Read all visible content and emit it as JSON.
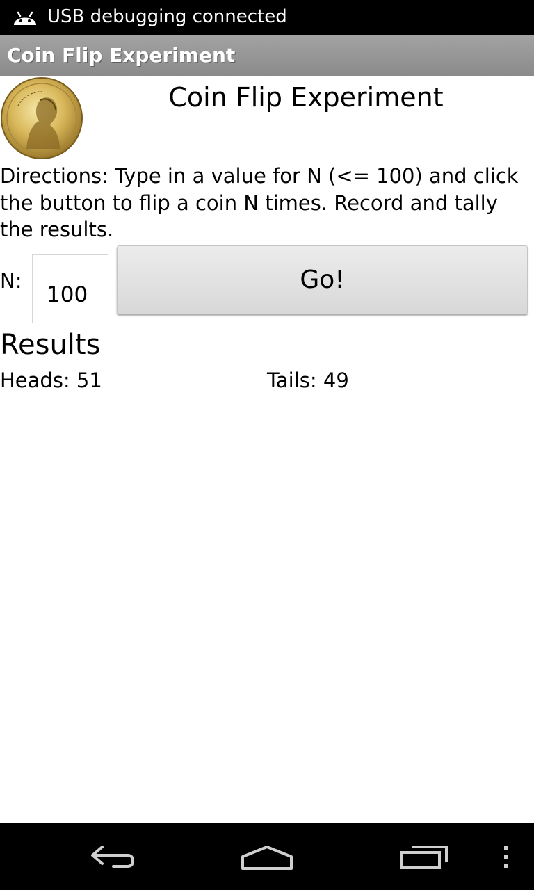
{
  "status_bar": {
    "text": "USB debugging connected",
    "icon": "android-debug-icon"
  },
  "action_bar": {
    "title": "Coin Flip Experiment"
  },
  "header": {
    "title": "Coin Flip Experiment",
    "image": "liberty-coin-image"
  },
  "directions": "Directions: Type in a value for N (<= 100) and click the button to flip a coin N times. Record and tally the results.",
  "input": {
    "label": "N:",
    "value": "100"
  },
  "go_button": {
    "label": "Go!"
  },
  "results": {
    "heading": "Results",
    "heads": "Heads: 51",
    "tails": "Tails:  49"
  },
  "nav_bar": {
    "back": "back-icon",
    "home": "home-icon",
    "recents": "recent-apps-icon",
    "menu": "overflow-menu-icon"
  },
  "colors": {
    "status_bar": "#000000",
    "action_bar": "#959595",
    "nav_bar": "#000000",
    "button": "#e0e0e0"
  }
}
